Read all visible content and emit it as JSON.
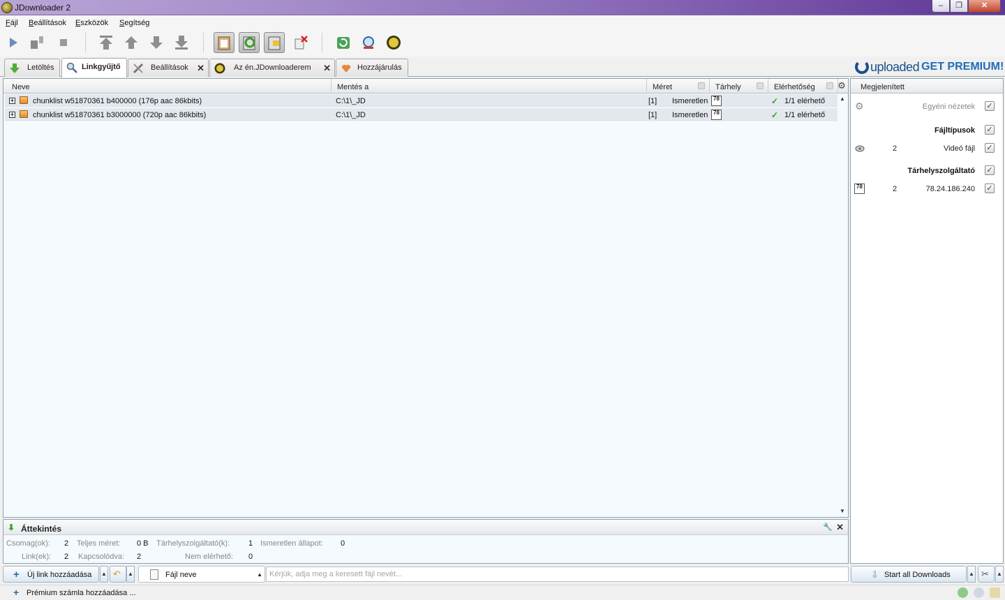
{
  "window": {
    "title": "JDownloader 2"
  },
  "menu": [
    "Fájl",
    "Beállítások",
    "Eszközök",
    "Segítség"
  ],
  "toolbar": {
    "icons": [
      "play-icon",
      "pause-icon",
      "stop-icon",
      "move-top-icon",
      "move-up-icon",
      "move-down-icon",
      "move-bottom-icon",
      "clipboard-observer-icon",
      "auto-confirm-icon",
      "auto-start-icon",
      "clear-linkgrabber-icon",
      "reconnect-icon",
      "update-icon",
      "myjdownloader-icon"
    ]
  },
  "tabs": [
    {
      "label": "Letöltés",
      "icon": "download-icon",
      "closable": false
    },
    {
      "label": "Linkgyűjtő",
      "icon": "magnifier-icon",
      "closable": false,
      "active": true
    },
    {
      "label": "Beállítások",
      "icon": "tools-icon",
      "closable": true
    },
    {
      "label": "Az én.JDownloaderem",
      "icon": "myjd-icon",
      "closable": true
    },
    {
      "label": "Hozzájárulás",
      "icon": "heart-icon",
      "closable": false
    }
  ],
  "premium_banner": {
    "brand": "uploaded",
    "cta": "GET PREMIUM!"
  },
  "table": {
    "columns": [
      "Neve",
      "Mentés a",
      "Méret",
      "Tárhely",
      "Elérhetőség"
    ],
    "rows": [
      {
        "name": "chunklist w51870361 b400000 (176p aac 86kbits)",
        "save_to": "C:\\1\\_JD",
        "count": "[1]",
        "size": "Ismeretlen",
        "host": "78",
        "availability": "1/1 elérhető"
      },
      {
        "name": "chunklist w51870361 b3000000 (720p aac 86kbits)",
        "save_to": "C:\\1\\_JD",
        "count": "[1]",
        "size": "Ismeretlen",
        "host": "78",
        "availability": "1/1 elérhető"
      }
    ]
  },
  "side_panel": {
    "header": "Megjelenített",
    "custom_views": "Egyéni nézetek",
    "file_types_title": "Fájltípusok",
    "file_type": {
      "count": "2",
      "label": "Videó fájl"
    },
    "hosters_title": "Tárhelyszolgáltató",
    "hoster": {
      "icon_text": "78",
      "count": "2",
      "label": "78.24.186.240"
    }
  },
  "overview": {
    "title": "Áttekintés",
    "packages_label": "Csomag(ok):",
    "packages": "2",
    "total_size_label": "Teljes méret:",
    "total_size": "0 B",
    "hosters_label": "Tárhelyszolgáltató(k):",
    "hosters": "1",
    "unknown_label": "Ismeretlen állapot:",
    "unknown": "0",
    "links_label": "Link(ek):",
    "links": "2",
    "connected_label": "Kapcsolódva:",
    "connected": "2",
    "unavailable_label": "Nem elérhető:",
    "unavailable": "0"
  },
  "bottombar": {
    "add_link": "Új link hozzáadása",
    "search_field": "Fájl neve",
    "search_placeholder": "Kérjük, adja meg a keresett fájl nevét...",
    "start_all": "Start all Downloads"
  },
  "statusbar": {
    "add_premium": "Prémium számla hozzáadása ..."
  }
}
